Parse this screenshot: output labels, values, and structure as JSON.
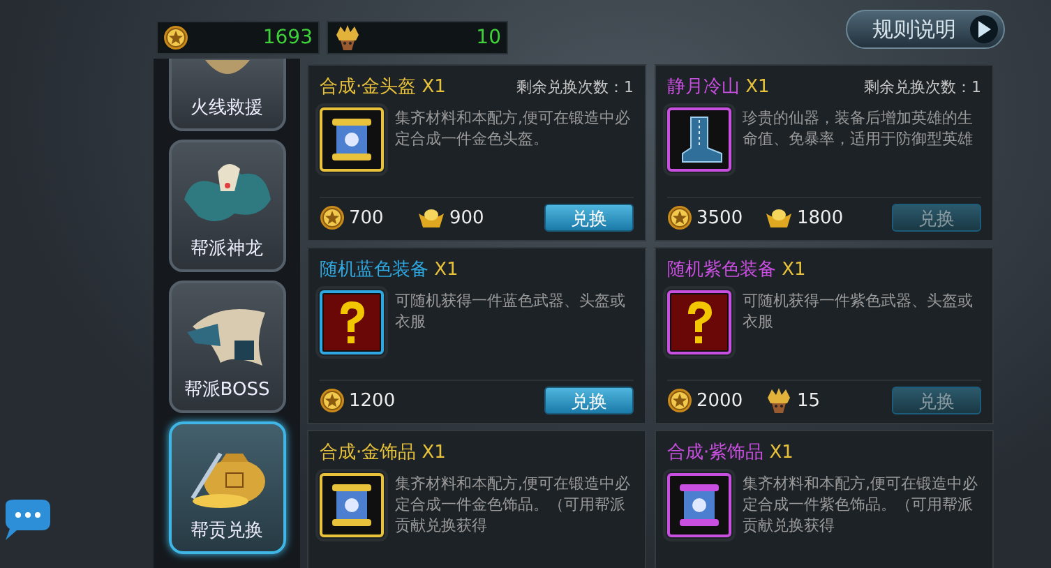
{
  "currencies": [
    {
      "kind": "coin",
      "amount": "1693"
    },
    {
      "kind": "token",
      "amount": "10"
    }
  ],
  "rules_button": {
    "label": "规则说明"
  },
  "sidebar": {
    "items": [
      {
        "label": "火线救援",
        "kind": "rescue",
        "selected": false
      },
      {
        "label": "帮派神龙",
        "kind": "dragon",
        "selected": false
      },
      {
        "label": "帮派BOSS",
        "kind": "beast",
        "selected": false
      },
      {
        "label": "帮贡兑换",
        "kind": "bag",
        "selected": true
      }
    ]
  },
  "items": [
    {
      "name": "合成·金头盔",
      "qty": "X1",
      "color": "#e8c23a",
      "remaining": "剩余兑换次数：1",
      "kind": "scroll",
      "description": "集齐材料和本配方,便可在锻造中必定合成一件金色头盔。",
      "costs": [
        {
          "kind": "coin",
          "amount": "700"
        },
        {
          "kind": "ingot",
          "amount": "900"
        }
      ],
      "button": {
        "label": "兑换",
        "disabled": false
      }
    },
    {
      "name": "静月冷山",
      "qty": "X1",
      "color": "#c94fe0",
      "remaining": "剩余兑换次数：1",
      "kind": "boot",
      "description": "珍贵的仙器，装备后增加英雄的生命值、免暴率，适用于防御型英雄",
      "costs": [
        {
          "kind": "coin",
          "amount": "3500"
        },
        {
          "kind": "ingot",
          "amount": "1800"
        }
      ],
      "button": {
        "label": "兑换",
        "disabled": true
      }
    },
    {
      "name": "随机蓝色装备",
      "qty": "X1",
      "color": "#2fa7e0",
      "kind": "mystery",
      "description": "可随机获得一件蓝色武器、头盔或衣服",
      "costs": [
        {
          "kind": "coin",
          "amount": "1200"
        }
      ],
      "button": {
        "label": "兑换",
        "disabled": false
      }
    },
    {
      "name": "随机紫色装备",
      "qty": "X1",
      "color": "#c94fe0",
      "kind": "mystery",
      "description": "可随机获得一件紫色武器、头盔或衣服",
      "costs": [
        {
          "kind": "coin",
          "amount": "2000"
        },
        {
          "kind": "token",
          "amount": "15"
        }
      ],
      "button": {
        "label": "兑换",
        "disabled": true
      }
    },
    {
      "name": "合成·金饰品",
      "qty": "X1",
      "color": "#e8c23a",
      "kind": "scroll",
      "description": "集齐材料和本配方,便可在锻造中必定合成一件金色饰品。（可用帮派贡献兑换获得"
    },
    {
      "name": "合成·紫饰品",
      "qty": "X1",
      "color": "#c94fe0",
      "kind": "scroll",
      "description": "集齐材料和本配方,便可在锻造中必定合成一件紫色饰品。（可用帮派贡献兑换获得"
    }
  ]
}
